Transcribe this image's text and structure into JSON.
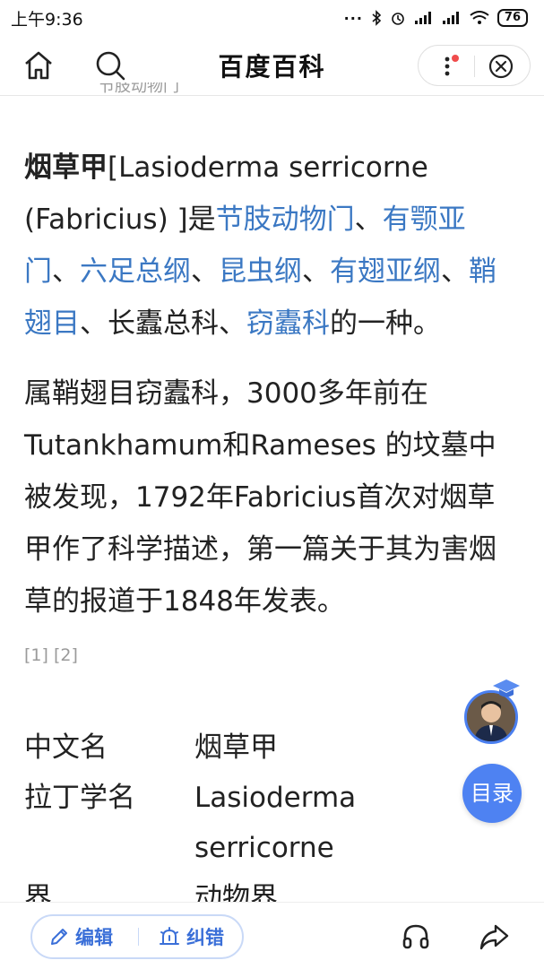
{
  "status_bar": {
    "time": "上午9:36",
    "signal_dots": "···",
    "battery": "76"
  },
  "header": {
    "title": "百度百科",
    "icons": [
      "home-icon",
      "search-icon",
      "more-icon",
      "close-icon"
    ],
    "notification_dot_color": "#f04c4c"
  },
  "article": {
    "cut_text": "节肢动物门",
    "intro": {
      "term": "烟草甲",
      "latin": "[Lasioderma serricorne (Fabricius) ]是",
      "link1": "节肢动物门",
      "sep1": "、",
      "link2": "有颚亚门",
      "sep2": "、",
      "link3": "六足总纲",
      "sep3": "、",
      "link4": "昆虫纲",
      "sep4": "、",
      "link5": "有翅亚纲",
      "sep5": "、",
      "link6": "鞘翅目",
      "sep6": "、长蠹总科、",
      "link7": "窃蠹科",
      "tail": "的一种。"
    },
    "history": "属鞘翅目窃蠹科，3000多年前在Tutankhamum和Rameses 的坟墓中被发现，1792年Fabricius首次对烟草甲作了科学描述，第一篇关于其为害烟草的报道于1848年发表。",
    "refs": "[1] [2]"
  },
  "infobox": {
    "rows": [
      {
        "label": "中文名",
        "value": "烟草甲"
      },
      {
        "label": "拉丁学名",
        "value": "Lasioderma serricorne"
      },
      {
        "label": "界",
        "value": "动物界"
      }
    ]
  },
  "floating": {
    "toc_label": "目录"
  },
  "bottom_bar": {
    "edit_label": "编辑",
    "report_label": "纠错"
  },
  "colors": {
    "link": "#3b78c3",
    "accent": "#4e82f2"
  }
}
